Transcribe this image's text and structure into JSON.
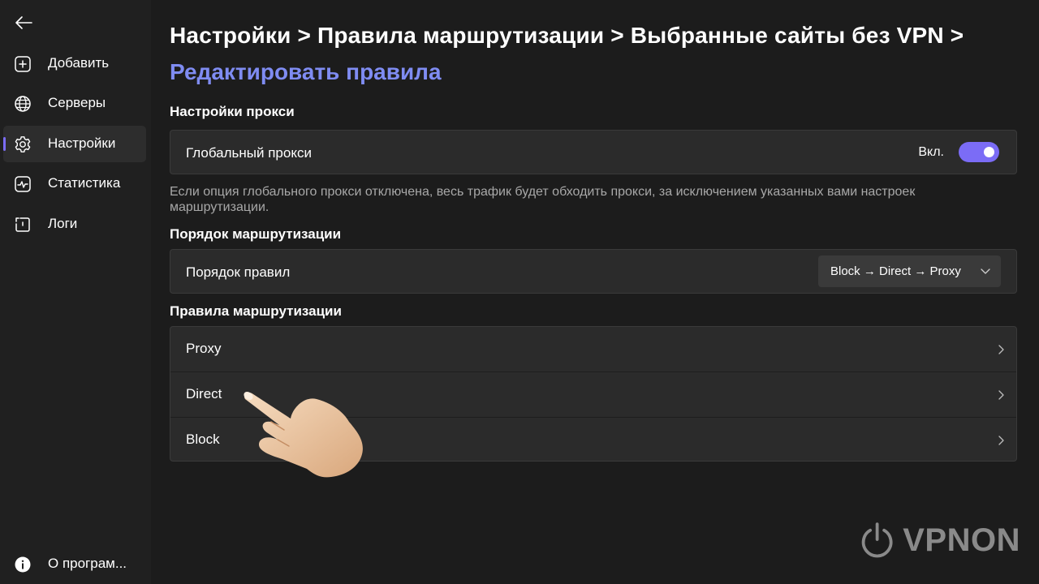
{
  "sidebar": {
    "items": [
      {
        "label": "Добавить",
        "icon": "add-box-icon"
      },
      {
        "label": "Серверы",
        "icon": "globe-icon"
      },
      {
        "label": "Настройки",
        "icon": "gear-icon",
        "active": true
      },
      {
        "label": "Статистика",
        "icon": "chart-icon"
      },
      {
        "label": "Логи",
        "icon": "log-icon"
      }
    ],
    "about_label": "О програм..."
  },
  "header": {
    "breadcrumb": "Настройки > Правила маршрутизации > Выбранные сайты без VPN >",
    "current": "Редактировать правила"
  },
  "proxy_settings": {
    "title": "Настройки прокси",
    "global_proxy_label": "Глобальный прокси",
    "toggle_state": "Вкл.",
    "toggle_on": true,
    "help_text": "Если опция глобального прокси отключена, весь трафик будет обходить прокси, за исключением указанных вами настроек маршрутизации."
  },
  "routing_order": {
    "title": "Порядок маршрутизации",
    "label": "Порядок правил",
    "selected": "Block → Direct → Proxy"
  },
  "routing_rules": {
    "title": "Правила маршрутизации",
    "rules": [
      "Proxy",
      "Direct",
      "Block"
    ]
  },
  "watermark": "VPNON",
  "colors": {
    "accent": "#7b6cf6",
    "breadcrumb_current": "#7f8cf2",
    "background": "#1c1c1c",
    "sidebar": "#202020",
    "card": "#2b2b2b"
  }
}
